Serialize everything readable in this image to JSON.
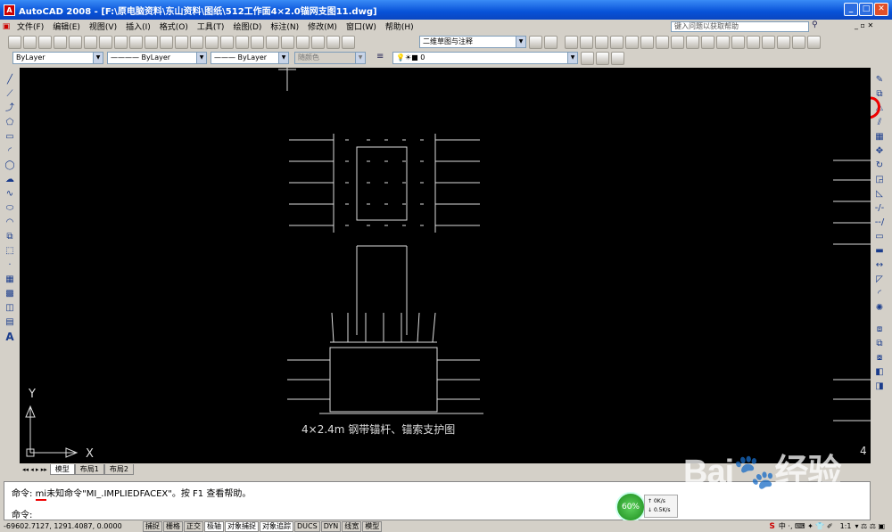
{
  "window": {
    "title": "AutoCAD 2008 - [F:\\原电脑资料\\东山资料\\图纸\\512工作面4×2.0锚网支图11.dwg]",
    "icon_text": "A"
  },
  "menu": [
    "文件(F)",
    "编辑(E)",
    "视图(V)",
    "插入(I)",
    "格式(O)",
    "工具(T)",
    "绘图(D)",
    "标注(N)",
    "修改(M)",
    "窗口(W)",
    "帮助(H)"
  ],
  "help_search": {
    "placeholder": "键入问题以获取帮助"
  },
  "toolbar": {
    "workspace": "二维草图与注释"
  },
  "properties": {
    "layer": "ByLayer",
    "linetype": "———— ByLayer",
    "lineweight": "——— ByLayer",
    "plotstyle": "随颜色",
    "layer_name": "0"
  },
  "drawing": {
    "caption": "4×2.4m 钢带锚杆、锚索支护图",
    "corner_label": "4",
    "ucs_x": "X",
    "ucs_y": "Y"
  },
  "layout_tabs": [
    "模型",
    "布局1",
    "布局2"
  ],
  "command": {
    "history_prefix": "命令:",
    "history_cmd": "mi",
    "history_msg": "未知命令\"MI_.IMPLIEDFACEX\"。按 F1 查看帮助。",
    "prompt": "命令:"
  },
  "status": {
    "coords": "-69602.7127, 1291.4087, 0.0000",
    "toggles": [
      "捕捉",
      "栅格",
      "正交",
      "极轴",
      "对象捕捉",
      "对象追踪",
      "DUCS",
      "DYN",
      "线宽",
      "模型"
    ],
    "scale": "1:1"
  },
  "network": {
    "percent": "60%",
    "up": "0K/s",
    "down": "0.5K/s"
  },
  "watermark": {
    "brand": "Bai",
    "brand2": "经验",
    "url": "jingyan.baidu.com"
  }
}
